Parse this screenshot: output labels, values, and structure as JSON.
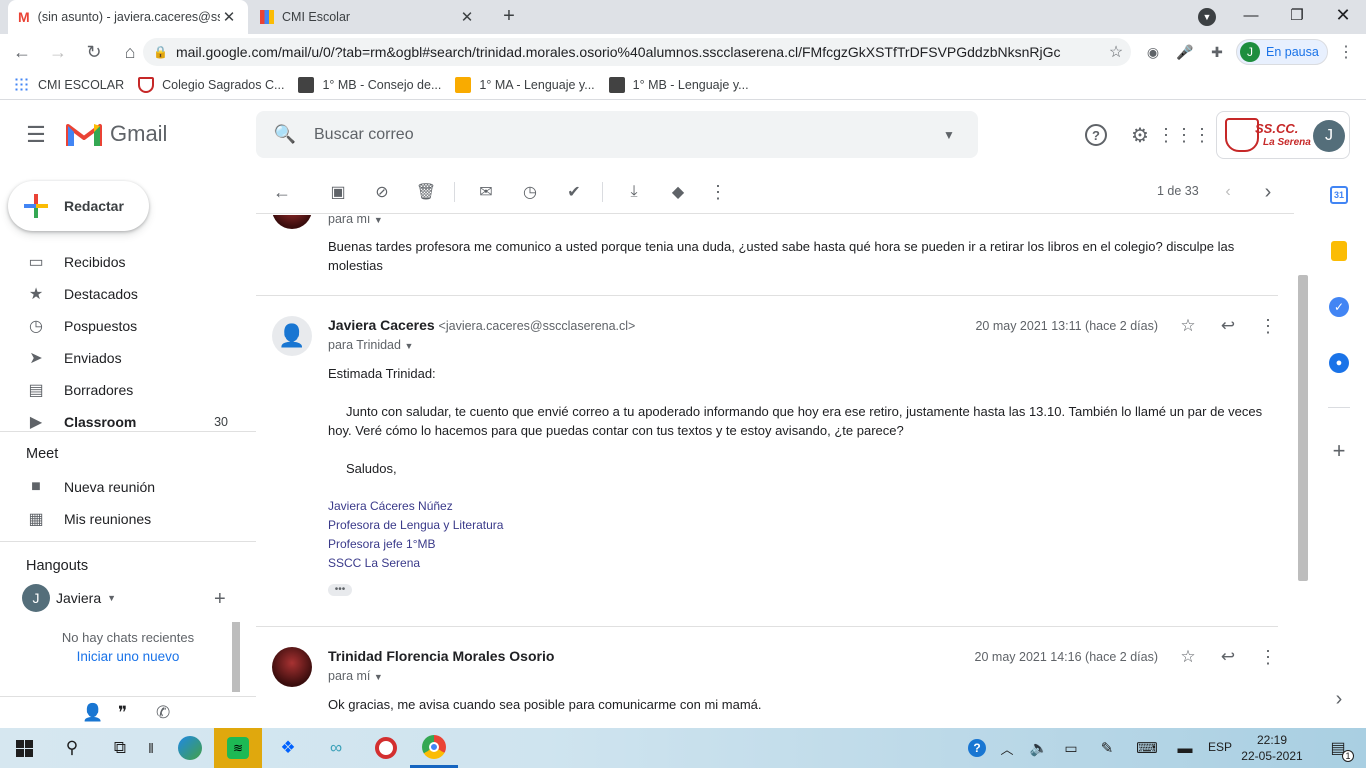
{
  "browser": {
    "tabs": [
      {
        "title": "(sin asunto) - javiera.caceres@ssc",
        "active": true
      },
      {
        "title": "CMI Escolar",
        "active": false
      }
    ],
    "new_tab": "+",
    "url": "mail.google.com/mail/u/0/?tab=rm&ogbl#search/trinidad.morales.osorio%40alumnos.sscclaserena.cl/FMfcgzGkXSTfTrDFSVPGddzbNksnRjGc",
    "profile_initial": "J",
    "profile_label": "En pausa",
    "bookmarks": [
      {
        "label": "CMI ESCOLAR",
        "color": "#4285f4"
      },
      {
        "label": "Colegio Sagrados C...",
        "color": "#c62828"
      },
      {
        "label": "1° MB - Consejo de...",
        "color": "#424242"
      },
      {
        "label": "1° MA - Lenguaje y...",
        "color": "#f9ab00"
      },
      {
        "label": "1° MB - Lenguaje y...",
        "color": "#424242"
      }
    ]
  },
  "gmail": {
    "logo_text": "Gmail",
    "search_placeholder": "Buscar correo",
    "org_logo_text": "SS.CC.",
    "org_logo_sub": "La Serena",
    "account_initial": "J",
    "compose_label": "Redactar",
    "nav": [
      {
        "label": "Recibidos",
        "icon": "inbox-icon",
        "count": ""
      },
      {
        "label": "Destacados",
        "icon": "star-icon",
        "count": ""
      },
      {
        "label": "Pospuestos",
        "icon": "clock-icon",
        "count": ""
      },
      {
        "label": "Enviados",
        "icon": "send-icon",
        "count": ""
      },
      {
        "label": "Borradores",
        "icon": "draft-icon",
        "count": ""
      },
      {
        "label": "Classroom",
        "icon": "label-icon",
        "count": "30"
      }
    ],
    "meet": {
      "title": "Meet",
      "items": [
        "Nueva reunión",
        "Mis reuniones"
      ]
    },
    "hangouts": {
      "title": "Hangouts",
      "user": "Javiera",
      "user_initial": "J",
      "empty_text": "No hay chats recientes",
      "start_link": "Iniciar uno nuevo"
    },
    "pagination": "1 de 33",
    "thread": [
      {
        "to": "para mí",
        "body": "Buenas tardes profesora me comunico a usted porque tenia una duda, ¿usted sabe hasta qué hora se pueden ir a retirar los libros en el colegio? disculpe las molestias"
      },
      {
        "sender": "Javiera Caceres",
        "email": "<javiera.caceres@sscclaserena.cl>",
        "to": "para Trinidad",
        "date": "20 may 2021 13:11 (hace 2 días)",
        "greeting": "Estimada Trinidad:",
        "body": "Junto con saludar, te cuento que envié correo a tu apoderado informando que hoy era ese retiro, justamente hasta las 13.10. También lo llamé un par de veces hoy. Veré cómo lo hacemos para que puedas contar con tus textos y te estoy avisando, ¿te parece?",
        "closing": "Saludos,",
        "signature": [
          "Javiera Cáceres Núñez",
          "Profesora de Lengua y Literatura",
          "Profesora jefe 1°MB",
          "SSCC La Serena"
        ],
        "trimmed": "•••"
      },
      {
        "sender": "Trinidad Florencia Morales Osorio",
        "to": "para mí",
        "date": "20 may 2021 14:16 (hace 2 días)",
        "body": "Ok gracias, me avisa cuando sea posible para comunicarme con mi mamá."
      }
    ]
  },
  "taskbar": {
    "lang": "ESP",
    "time": "22:19",
    "date": "22-05-2021",
    "notif_count": "1"
  }
}
